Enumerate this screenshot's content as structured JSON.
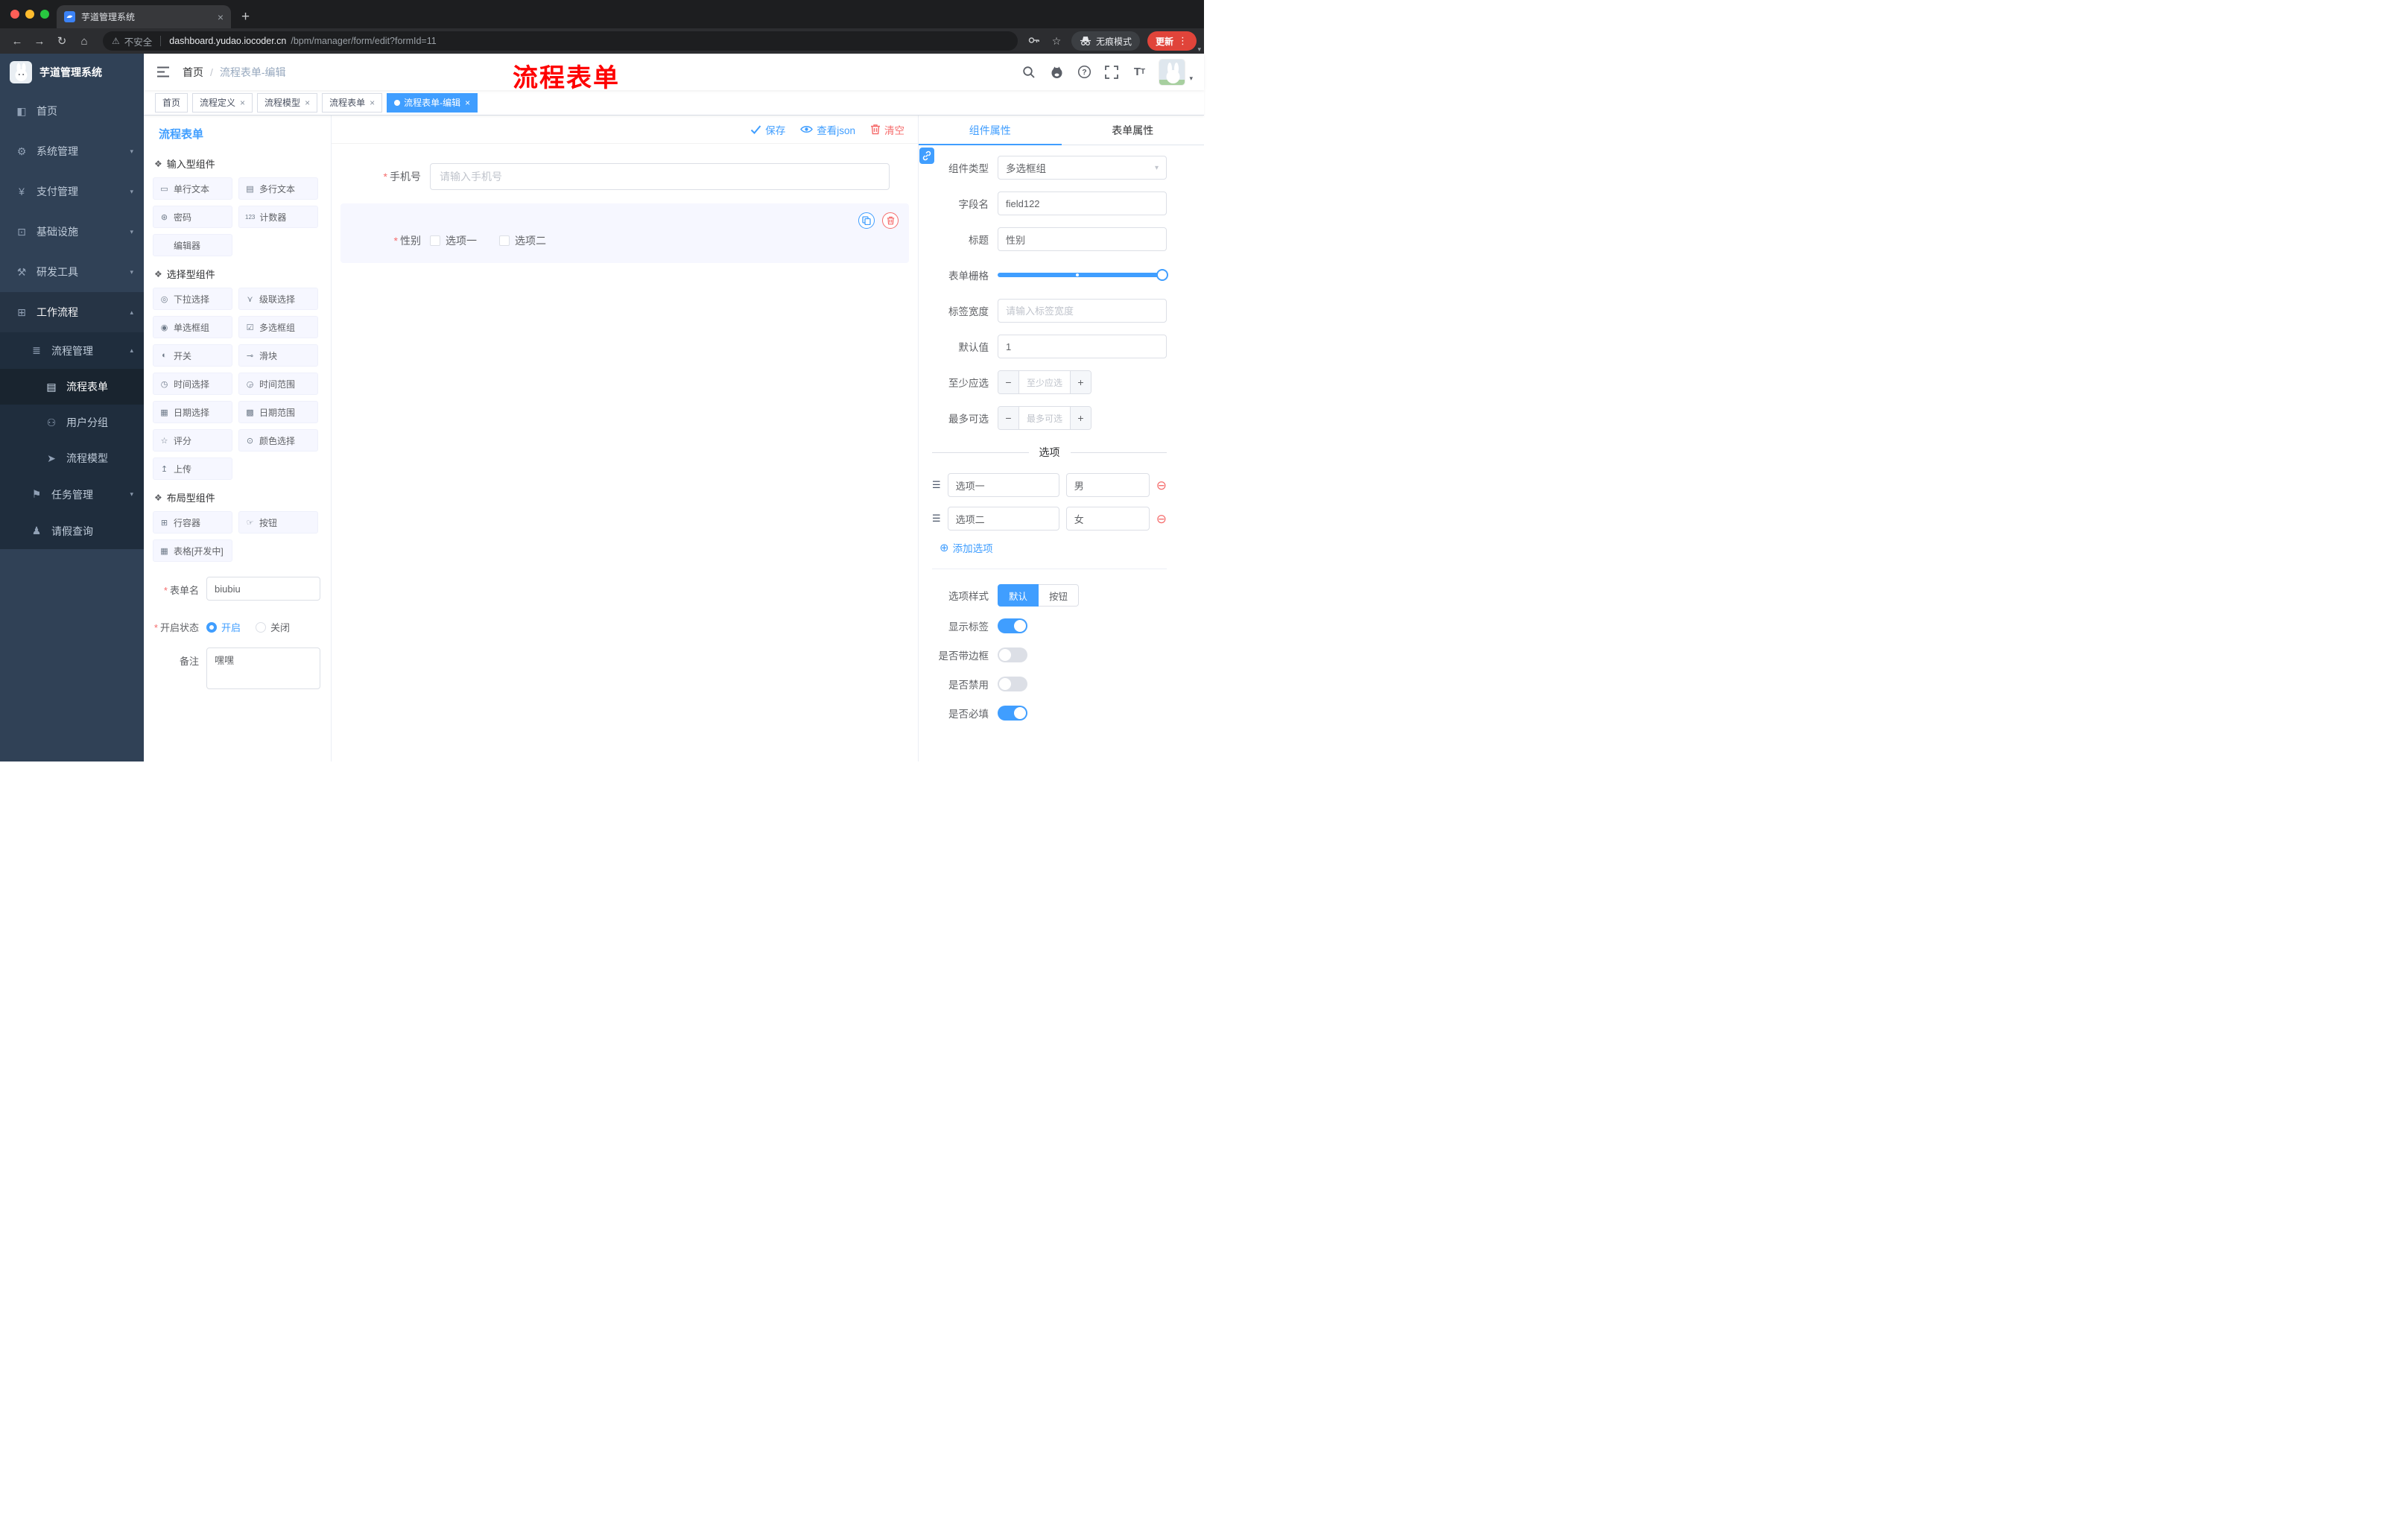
{
  "browser": {
    "tab_title": "芋道管理系统",
    "security_label": "不安全",
    "url_domain": "dashboard.yudao.iocoder.cn",
    "url_path": "/bpm/manager/form/edit?formId=11",
    "incognito_label": "无痕模式",
    "update_label": "更新"
  },
  "sidebar": {
    "brand": "芋道管理系统",
    "items": [
      {
        "label": "首页",
        "icon": "◧"
      },
      {
        "label": "系统管理",
        "icon": "⚙"
      },
      {
        "label": "支付管理",
        "icon": "¥"
      },
      {
        "label": "基础设施",
        "icon": "⊡"
      },
      {
        "label": "研发工具",
        "icon": "⚒"
      },
      {
        "label": "工作流程",
        "icon": "⊞"
      },
      {
        "label": "流程管理",
        "icon": "≣"
      },
      {
        "label": "流程表单",
        "icon": "▤"
      },
      {
        "label": "用户分组",
        "icon": "⚇"
      },
      {
        "label": "流程模型",
        "icon": "➤"
      },
      {
        "label": "任务管理",
        "icon": "⚑"
      },
      {
        "label": "请假查询",
        "icon": "♟"
      }
    ]
  },
  "header": {
    "breadcrumb_home": "首页",
    "breadcrumb_sep": "/",
    "breadcrumb_current": "流程表单-编辑",
    "annotation": "流程表单"
  },
  "tags": [
    {
      "label": "首页"
    },
    {
      "label": "流程定义"
    },
    {
      "label": "流程模型"
    },
    {
      "label": "流程表单"
    },
    {
      "label": "流程表单-编辑"
    }
  ],
  "designer": {
    "panel_title": "流程表单",
    "groups": [
      {
        "title": "输入型组件",
        "icon": "❖",
        "items": [
          {
            "label": "单行文本",
            "icon": "▭"
          },
          {
            "label": "多行文本",
            "icon": "▤"
          },
          {
            "label": "密码",
            "icon": "⊛"
          },
          {
            "label": "计数器",
            "icon": "123"
          },
          {
            "label": "编辑器",
            "icon": ""
          }
        ]
      },
      {
        "title": "选择型组件",
        "icon": "❖",
        "items": [
          {
            "label": "下拉选择",
            "icon": "◎"
          },
          {
            "label": "级联选择",
            "icon": "⋎"
          },
          {
            "label": "单选框组",
            "icon": "◉"
          },
          {
            "label": "多选框组",
            "icon": "☑"
          },
          {
            "label": "开关",
            "icon": "◐"
          },
          {
            "label": "滑块",
            "icon": "⊸"
          },
          {
            "label": "时间选择",
            "icon": "◷"
          },
          {
            "label": "时间范围",
            "icon": "◶"
          },
          {
            "label": "日期选择",
            "icon": "▦"
          },
          {
            "label": "日期范围",
            "icon": "▩"
          },
          {
            "label": "评分",
            "icon": "☆"
          },
          {
            "label": "颜色选择",
            "icon": "⊙"
          },
          {
            "label": "上传",
            "icon": "↥"
          }
        ]
      },
      {
        "title": "布局型组件",
        "icon": "❖",
        "items": [
          {
            "label": "行容器",
            "icon": "⊞"
          },
          {
            "label": "按钮",
            "icon": "☞"
          },
          {
            "label": "表格[开发中]",
            "icon": "▦"
          }
        ]
      }
    ],
    "meta": {
      "form_name_label": "表单名",
      "form_name_value": "biubiu",
      "status_label": "开启状态",
      "status_options": [
        "开启",
        "关闭"
      ],
      "remark_label": "备注",
      "remark_value": "嘿嘿"
    },
    "actions": {
      "save": "保存",
      "view_json": "查看json",
      "clear": "清空"
    },
    "canvas": {
      "phone": {
        "label": "手机号",
        "placeholder": "请输入手机号"
      },
      "gender": {
        "label": "性别",
        "options": [
          "选项一",
          "选项二"
        ]
      }
    }
  },
  "props": {
    "tabs": [
      "组件属性",
      "表单属性"
    ],
    "rows": {
      "component_type": {
        "label": "组件类型",
        "value": "多选框组"
      },
      "field_name": {
        "label": "字段名",
        "value": "field122"
      },
      "title": {
        "label": "标题",
        "value": "性别"
      },
      "grid": {
        "label": "表单栅格"
      },
      "label_width": {
        "label": "标签宽度",
        "placeholder": "请输入标签宽度"
      },
      "default_value": {
        "label": "默认值",
        "value": "1"
      },
      "min_select": {
        "label": "至少应选",
        "placeholder": "至少应选"
      },
      "max_select": {
        "label": "最多可选",
        "placeholder": "最多可选"
      }
    },
    "options_section": {
      "divider": "选项",
      "options": [
        {
          "label": "选项一",
          "value": "男"
        },
        {
          "label": "选项二",
          "value": "女"
        }
      ],
      "add": "添加选项"
    },
    "style_row": {
      "label": "选项样式",
      "choices": [
        "默认",
        "按钮"
      ]
    },
    "switch_rows": [
      {
        "label": "显示标签",
        "on": true
      },
      {
        "label": "是否带边框",
        "on": false
      },
      {
        "label": "是否禁用",
        "on": false
      },
      {
        "label": "是否必填",
        "on": true
      }
    ]
  },
  "colors": {
    "accent": "#409eff",
    "danger": "#f56c6c",
    "annotation": "#fe0000"
  }
}
